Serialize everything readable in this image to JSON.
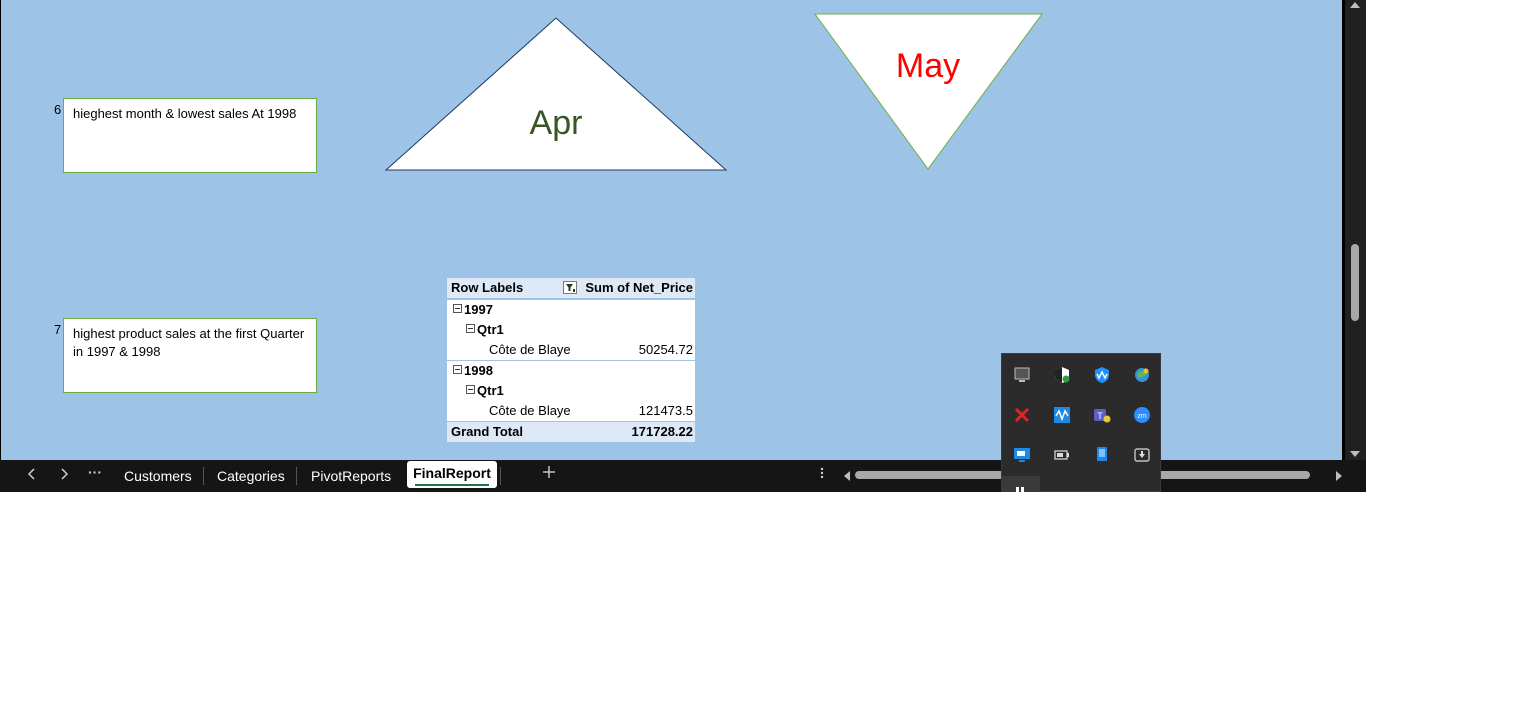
{
  "sheet": {
    "row_numbers": [
      "6",
      "7"
    ],
    "textboxes": [
      "hieghest month & lowest sales At 1998",
      "highest product sales at the first Quarter in 1997 & 1998"
    ],
    "shapes": {
      "triangle_up_label": "Apr",
      "triangle_down_label": "May",
      "triangle_up_label_color": "#375623",
      "triangle_down_label_color": "#ff0000"
    }
  },
  "pivot": {
    "header": {
      "row_labels": "Row Labels",
      "value_header": "Sum of Net_Price"
    },
    "groups": [
      {
        "year": "1997",
        "quarter": "Qtr1",
        "product": "Côte de Blaye",
        "value": "50254.72"
      },
      {
        "year": "1998",
        "quarter": "Qtr1",
        "product": "Côte de Blaye",
        "value": "121473.5"
      }
    ],
    "grand_total_label": "Grand Total",
    "grand_total_value": "171728.22"
  },
  "tabs": {
    "prev_icon": "chevron-left",
    "next_icon": "chevron-right",
    "more_icon": "ellipsis",
    "sheets": [
      "Customers",
      "Categories",
      "PivotReports"
    ],
    "active_sheet": "FinalReport",
    "add_icon": "plus"
  },
  "tray_icons": [
    "desktop-icon",
    "security-shield-icon",
    "malwarebytes-icon",
    "network-globe-icon",
    "disabled-tool-icon",
    "waves-audio-icon",
    "teams-icon",
    "zoom-icon",
    "remote-desktop-icon",
    "battery-icon",
    "phone-link-icon",
    "safely-remove-icon"
  ],
  "colors": {
    "sheet_background": "#9dc3e6",
    "textbox_border": "#70ad47",
    "pivot_header": "#dde9f7",
    "active_tab_underline": "#217346"
  }
}
